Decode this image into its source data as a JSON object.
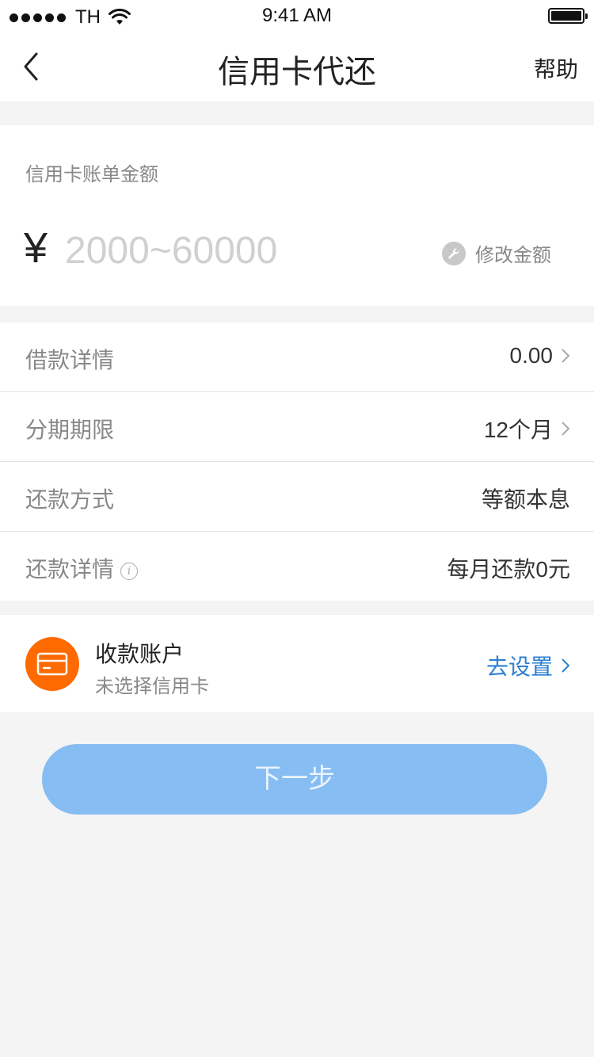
{
  "status_bar": {
    "carrier": "TH",
    "time": "9:41 AM"
  },
  "nav": {
    "title": "信用卡代还",
    "help_label": "帮助"
  },
  "amount": {
    "label": "信用卡账单金额",
    "currency_symbol": "¥",
    "placeholder": "2000~60000",
    "edit_label": "修改金额"
  },
  "details": {
    "rows": [
      {
        "label": "借款详情",
        "value": "0.00"
      },
      {
        "label": "分期期限",
        "value": "12个月"
      },
      {
        "label": "还款方式",
        "value": "等额本息"
      },
      {
        "label": "还款详情",
        "value": "每月还款0元"
      }
    ]
  },
  "account": {
    "title": "收款账户",
    "subtitle": "未选择信用卡",
    "action_label": "去设置"
  },
  "next_button_label": "下一步",
  "colors": {
    "accent_blue": "#2c7fd2",
    "button_blue": "#86bdf2",
    "orange": "#ff6a00"
  }
}
